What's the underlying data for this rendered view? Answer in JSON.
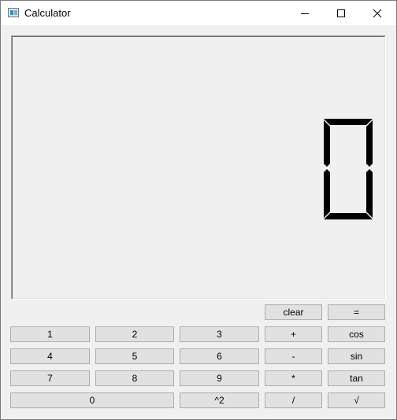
{
  "window": {
    "title": "Calculator",
    "icons": {
      "app": "calculator-app-icon",
      "minimize": "minimize-icon",
      "maximize": "maximize-icon",
      "close": "close-icon"
    }
  },
  "display": {
    "value": "0"
  },
  "buttons": {
    "clear": "clear",
    "equals": "=",
    "one": "1",
    "two": "2",
    "three": "3",
    "plus": "+",
    "cos": "cos",
    "four": "4",
    "five": "5",
    "six": "6",
    "minus": "-",
    "sin": "sin",
    "seven": "7",
    "eight": "8",
    "nine": "9",
    "multiply": "*",
    "tan": "tan",
    "zero": "0",
    "square": "^2",
    "divide": "/",
    "sqrt": "√"
  }
}
